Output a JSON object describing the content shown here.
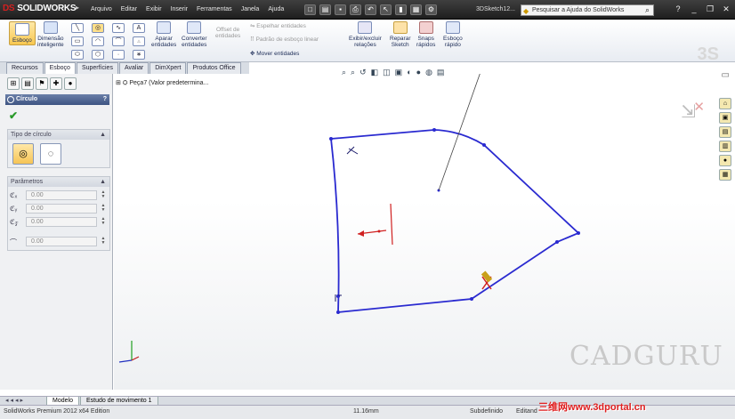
{
  "app": {
    "name": "SOLIDWORKS",
    "brand_prefix": "DS",
    "document_title": "3DSketch12..."
  },
  "menu": {
    "items": [
      "Arquivo",
      "Editar",
      "Exibir",
      "Inserir",
      "Ferramentas",
      "Janela",
      "Ajuda"
    ]
  },
  "help": {
    "placeholder": "Pesquisar a Ajuda do SolidWorks"
  },
  "ribbon": {
    "esboco": "Esboço",
    "dimensao": [
      "Dimensão",
      "inteligente"
    ],
    "aparar": [
      "Aparar",
      "entidades"
    ],
    "converter": [
      "Converter",
      "entidades"
    ],
    "offset": [
      "Offset de",
      "entidades"
    ],
    "espelhar": "Espelhar entidades",
    "padrao": "Padrão de esboço linear",
    "mover": "Mover entidades",
    "exibir": [
      "Exibir/excluir",
      "relações"
    ],
    "reparar": [
      "Reparar",
      "Sketch"
    ],
    "snaps": [
      "Snaps",
      "rápidos"
    ],
    "esboco_rapido": [
      "Esboço",
      "rápido"
    ]
  },
  "tabs": {
    "items": [
      "Recursos",
      "Esboço",
      "Superfícies",
      "Avaliar",
      "DimXpert",
      "Produtos Office"
    ],
    "selected": 1
  },
  "property_manager": {
    "title": "Círculo",
    "help": "?",
    "group_tipo": "Tipo de círculo",
    "group_params": "Parâmetros",
    "params": [
      "0.00",
      "0.00",
      "0.00",
      "0.00"
    ]
  },
  "tree": {
    "label": "Peça7  (Valor predetermina..."
  },
  "watermark": {
    "text": "CADGURU"
  },
  "bottom_tabs": {
    "items": [
      "Modelo",
      "Estudo de movimento 1"
    ]
  },
  "status": {
    "edition": "SolidWorks Premium 2012 x64 Edition",
    "value": "11.16mm",
    "state": "Subdefinido",
    "mode": "Editand"
  },
  "site_watermark": {
    "text": "三维网www.3dportal.cn"
  },
  "colors": {
    "sketch": "#2a2ad0",
    "accent": "#f6c455",
    "title_bar": "#2a2a2a"
  }
}
